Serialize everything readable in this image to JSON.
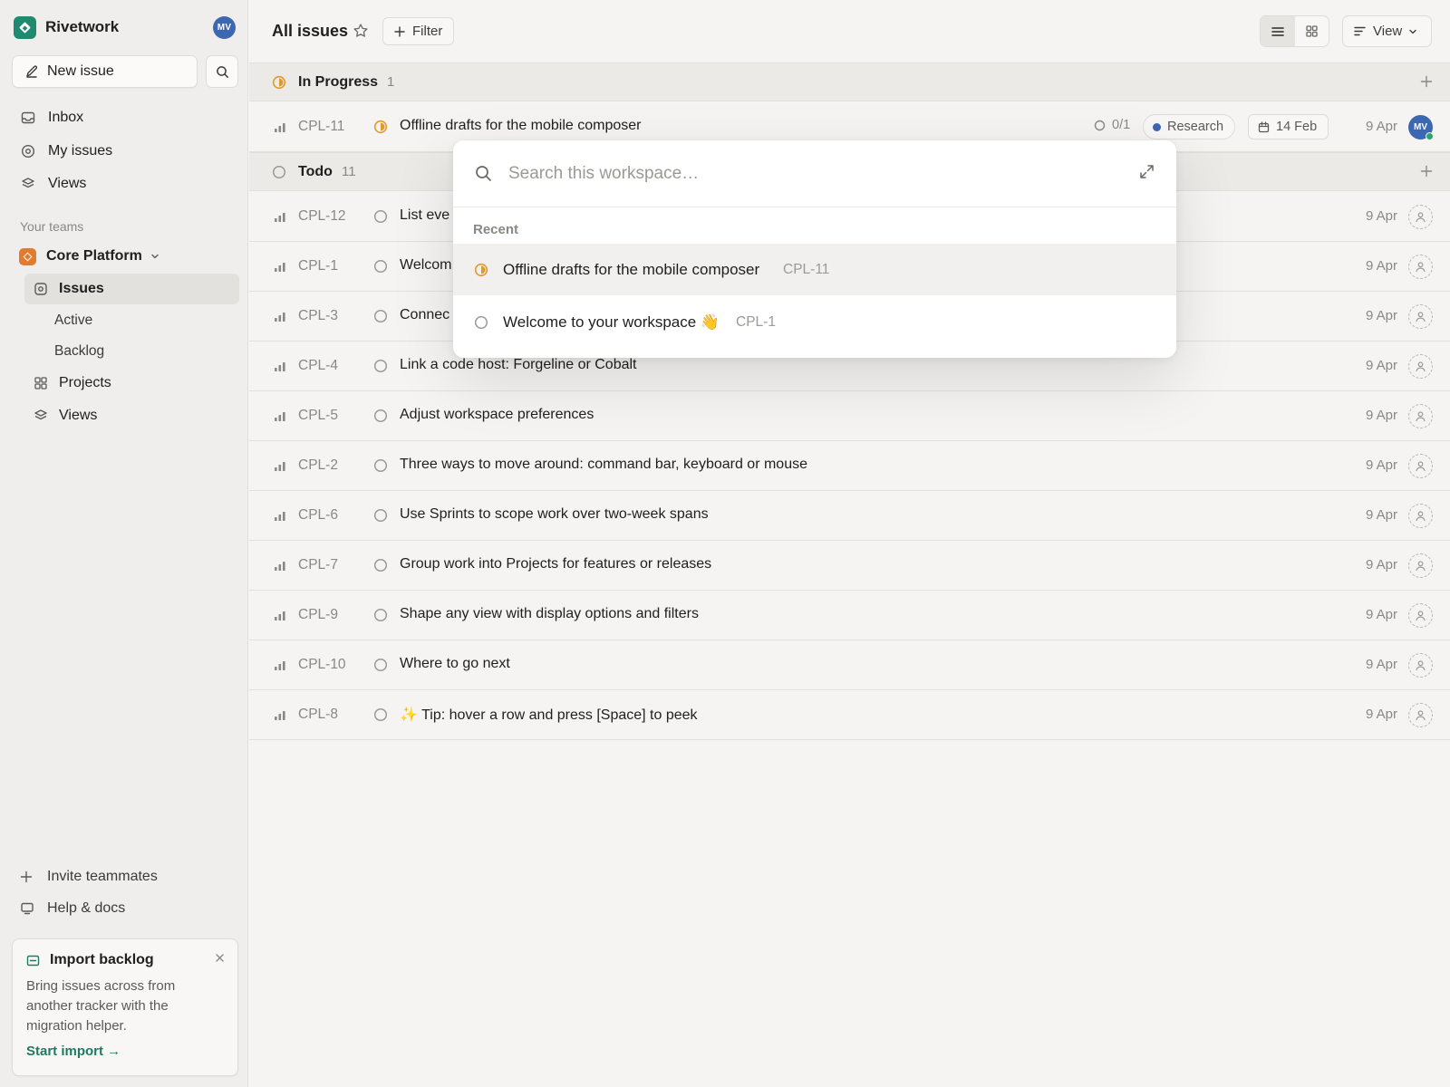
{
  "workspace": {
    "name": "Rivetwork",
    "user_initials": "MV"
  },
  "sidebar": {
    "new_issue_label": "New issue",
    "nav": [
      {
        "label": "Inbox",
        "icon": "inbox-icon"
      },
      {
        "label": "My issues",
        "icon": "target-icon"
      },
      {
        "label": "Views",
        "icon": "layers-icon"
      }
    ],
    "teams_label": "Your teams",
    "team": {
      "name": "Core Platform",
      "items": [
        {
          "label": "Issues",
          "icon": "issues-icon",
          "selected": true
        },
        {
          "label": "Active"
        },
        {
          "label": "Backlog"
        },
        {
          "label": "Projects",
          "icon": "grid-icon"
        },
        {
          "label": "Views",
          "icon": "layers-icon"
        }
      ]
    },
    "bottom": [
      {
        "label": "Invite teammates",
        "icon": "plus-icon"
      },
      {
        "label": "Help & docs",
        "icon": "monitor-icon"
      }
    ],
    "import_card": {
      "title": "Import backlog",
      "body": "Bring issues across from another tracker with the migration helper.",
      "link": "Start import →"
    }
  },
  "header": {
    "title": "All issues",
    "filter_label": "Filter",
    "view_label": "View"
  },
  "groups": [
    {
      "name": "In Progress",
      "count": "1",
      "issues": [
        {
          "id": "CPL-11",
          "title": "Offline drafts for the mobile composer",
          "subissues": "0/1",
          "label": "Research",
          "due": "14 Feb",
          "date": "9 Apr",
          "assignee": "MV"
        }
      ]
    },
    {
      "name": "Todo",
      "count": "11",
      "issues": [
        {
          "id": "CPL-12",
          "title": "List eve",
          "date": "9 Apr"
        },
        {
          "id": "CPL-1",
          "title": "Welcom",
          "date": "9 Apr"
        },
        {
          "id": "CPL-3",
          "title": "Connec",
          "date": "9 Apr"
        },
        {
          "id": "CPL-4",
          "title": "Link a code host: Forgeline or Cobalt",
          "date": "9 Apr"
        },
        {
          "id": "CPL-5",
          "title": "Adjust workspace preferences",
          "date": "9 Apr"
        },
        {
          "id": "CPL-2",
          "title": "Three ways to move around: command bar, keyboard or mouse",
          "date": "9 Apr"
        },
        {
          "id": "CPL-6",
          "title": "Use Sprints to scope work over two-week spans",
          "date": "9 Apr"
        },
        {
          "id": "CPL-7",
          "title": "Group work into Projects for features or releases",
          "date": "9 Apr"
        },
        {
          "id": "CPL-9",
          "title": "Shape any view with display options and filters",
          "date": "9 Apr"
        },
        {
          "id": "CPL-10",
          "title": "Where to go next",
          "date": "9 Apr"
        },
        {
          "id": "CPL-8",
          "title": "✨ Tip: hover a row and press [Space] to peek",
          "date": "9 Apr"
        }
      ]
    }
  ],
  "palette": {
    "placeholder": "Search this workspace…",
    "section": "Recent",
    "items": [
      {
        "title": "Offline drafts for the mobile composer",
        "id": "CPL-11",
        "status": "in-progress"
      },
      {
        "title": "Welcome to your workspace 👋",
        "id": "CPL-1",
        "status": "todo"
      }
    ]
  },
  "colors": {
    "brand": "#1f8a70",
    "team": "#e07b2f",
    "in_progress": "#e09a2c",
    "avatar": "#3d67b0",
    "link": "#1f7a62"
  }
}
